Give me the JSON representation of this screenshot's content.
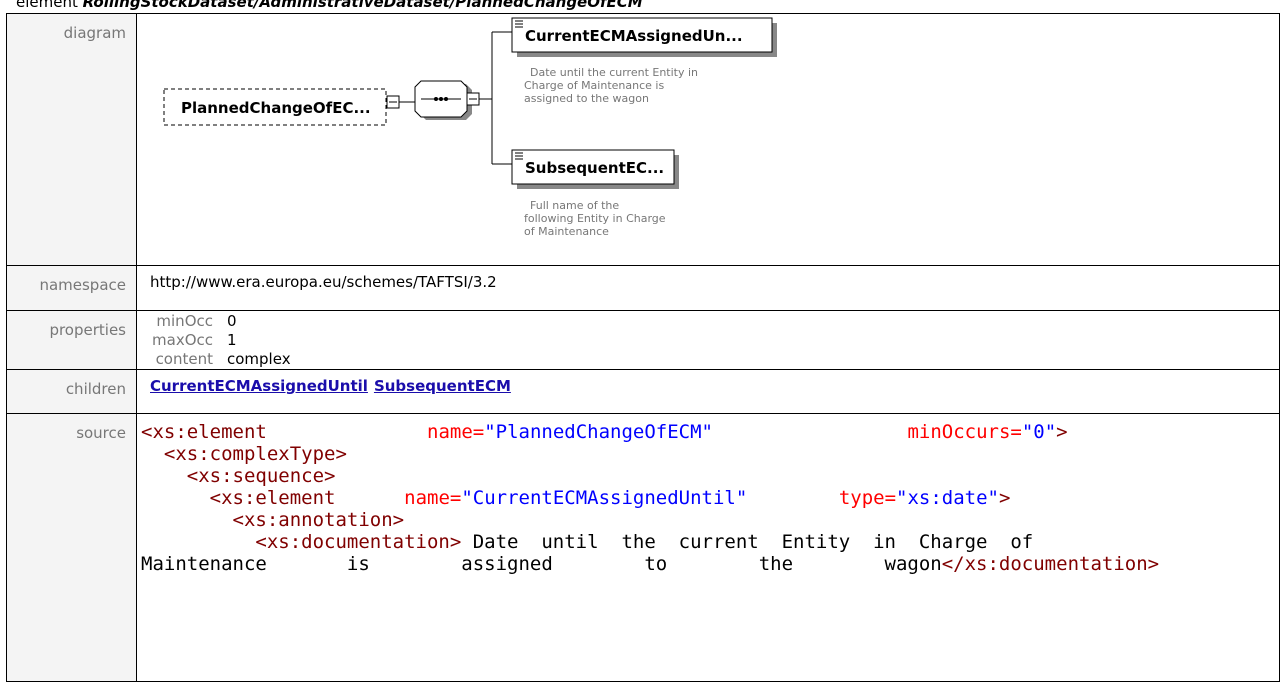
{
  "heading": {
    "prefix": "element ",
    "path": "RollingStockDataset/AdministrativeDataset/PlannedChangeOfECM"
  },
  "rows": {
    "diagram_label": "diagram",
    "namespace_label": "namespace",
    "namespace_value": "http://www.era.europa.eu/schemes/TAFTSI/3.2",
    "properties_label": "properties",
    "children_label": "children",
    "source_label": "source"
  },
  "diagram": {
    "root": "PlannedChangeOfEC...",
    "child1": "CurrentECMAssignedUn...",
    "child1_doc": [
      "Date until the current Entity in",
      "Charge of Maintenance is",
      "assigned to the wagon"
    ],
    "child2": "SubsequentEC...",
    "child2_doc": [
      "Full name of the",
      "following Entity in Charge",
      "of Maintenance"
    ]
  },
  "properties": [
    {
      "key": "minOcc",
      "value": "0"
    },
    {
      "key": "maxOcc",
      "value": "1"
    },
    {
      "key": "content",
      "value": "complex"
    }
  ],
  "children": [
    "CurrentECMAssignedUntil",
    "SubsequentECM"
  ],
  "source": {
    "l1": {
      "t1": "<xs:element",
      "a1": "name=",
      "v1": "\"PlannedChangeOfECM\"",
      "a2": "minOccurs=",
      "v2": "\"0\"",
      "t2": ">"
    },
    "l2": "<xs:complexType>",
    "l3": "<xs:sequence>",
    "l4": {
      "t1": "<xs:element",
      "a1": "name=",
      "v1": "\"CurrentECMAssignedUntil\"",
      "a2": "type=",
      "v2": "\"xs:date\"",
      "t2": ">"
    },
    "l5": "<xs:annotation>",
    "l6": {
      "t1": "<xs:documentation>",
      "text": " Date  until  the  current  Entity  in  Charge  of"
    },
    "l7": {
      "text": "Maintenance       is        assigned        to        the        wagon",
      "t1": "</xs:documentation>"
    }
  }
}
